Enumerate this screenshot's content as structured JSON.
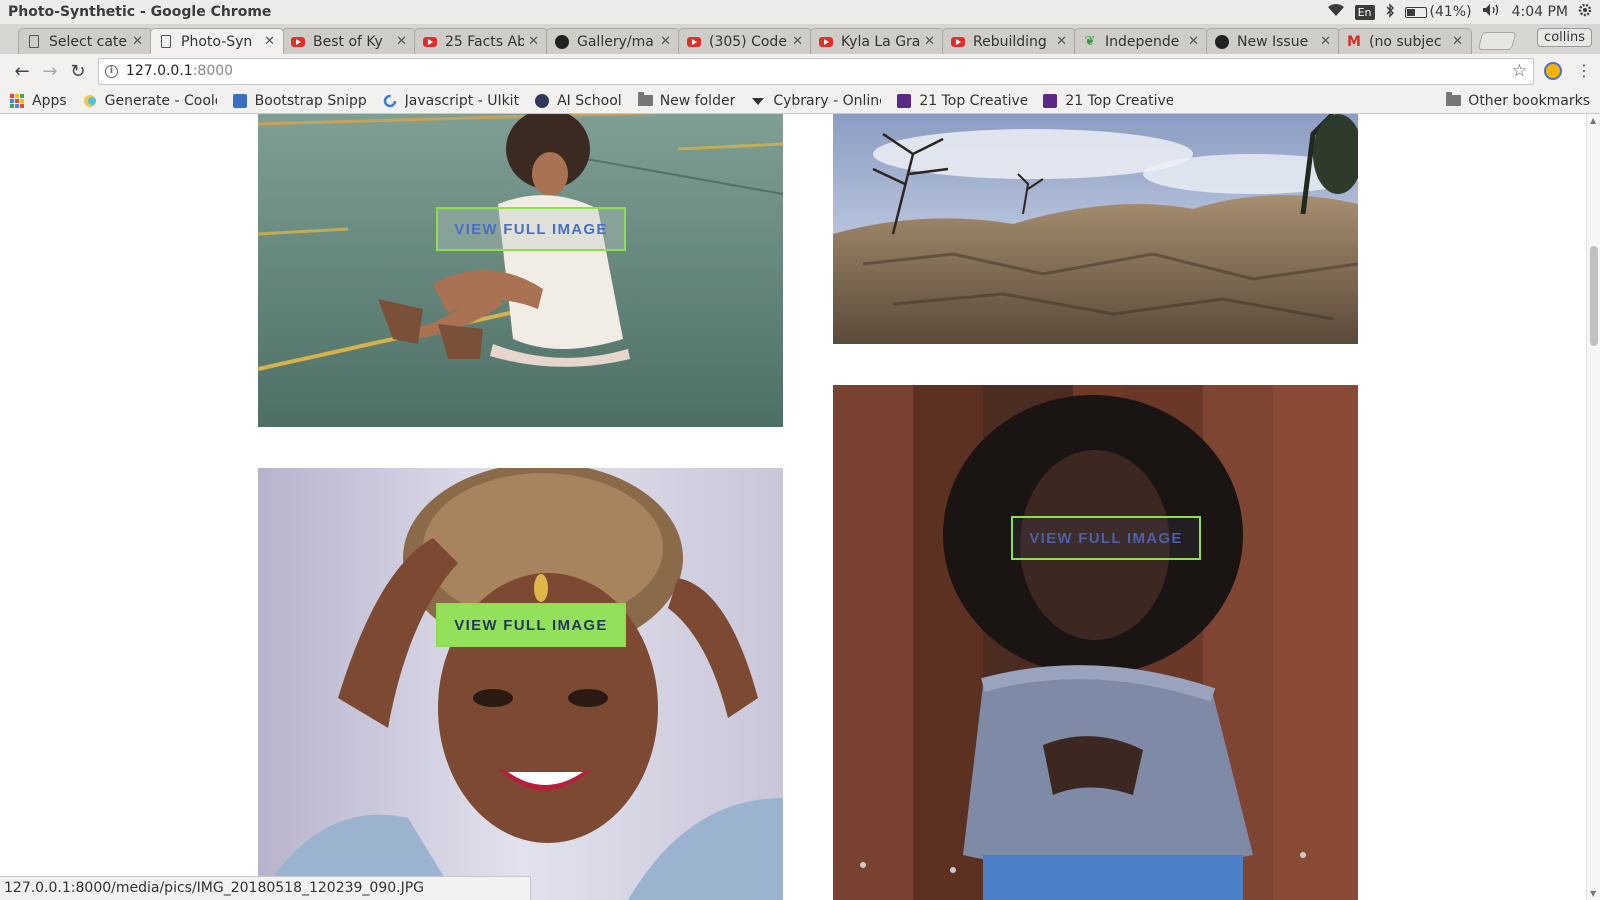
{
  "window": {
    "title": "Photo-Synthetic - Google Chrome",
    "lang": "En",
    "battery": "(41%)",
    "time": "4:04 PM",
    "profile": "collins"
  },
  "tabs": [
    {
      "label": "Select cate",
      "icon": "document-icon"
    },
    {
      "label": "Photo-Syn",
      "icon": "document-icon"
    },
    {
      "label": "Best of Ky",
      "icon": "youtube-icon"
    },
    {
      "label": "25 Facts Ab",
      "icon": "youtube-icon"
    },
    {
      "label": "Gallery/ma",
      "icon": "github-icon"
    },
    {
      "label": "(305) Code",
      "icon": "youtube-icon"
    },
    {
      "label": "Kyla La Gra",
      "icon": "youtube-icon"
    },
    {
      "label": "Rebuilding",
      "icon": "youtube-icon"
    },
    {
      "label": "Independe",
      "icon": "leaf-icon"
    },
    {
      "label": "New Issue",
      "icon": "github-icon"
    },
    {
      "label": "(no subjec",
      "icon": "gmail-icon"
    }
  ],
  "toolbar": {
    "url_host": "127.0.0.1",
    "url_port": ":8000"
  },
  "bookmarks": [
    {
      "label": "Apps"
    },
    {
      "label": "Generate - Coolo"
    },
    {
      "label": "Bootstrap Snipp"
    },
    {
      "label": "Javascript - UIkit"
    },
    {
      "label": "AI School"
    },
    {
      "label": "New folder"
    },
    {
      "label": "Cybrary - Online"
    },
    {
      "label": "21 Top Creative"
    },
    {
      "label": "21 Top Creative"
    },
    {
      "label": "Other bookmarks"
    }
  ],
  "gallery": {
    "button_label": "VIEW FULL IMAGE",
    "colors": {
      "button_border": "#8de04b",
      "button_fill": "#93e15a",
      "button_text": "#4a6fc7"
    }
  },
  "status_url": "127.0.0.1:8000/media/pics/IMG_20180518_120239_090.JPG"
}
